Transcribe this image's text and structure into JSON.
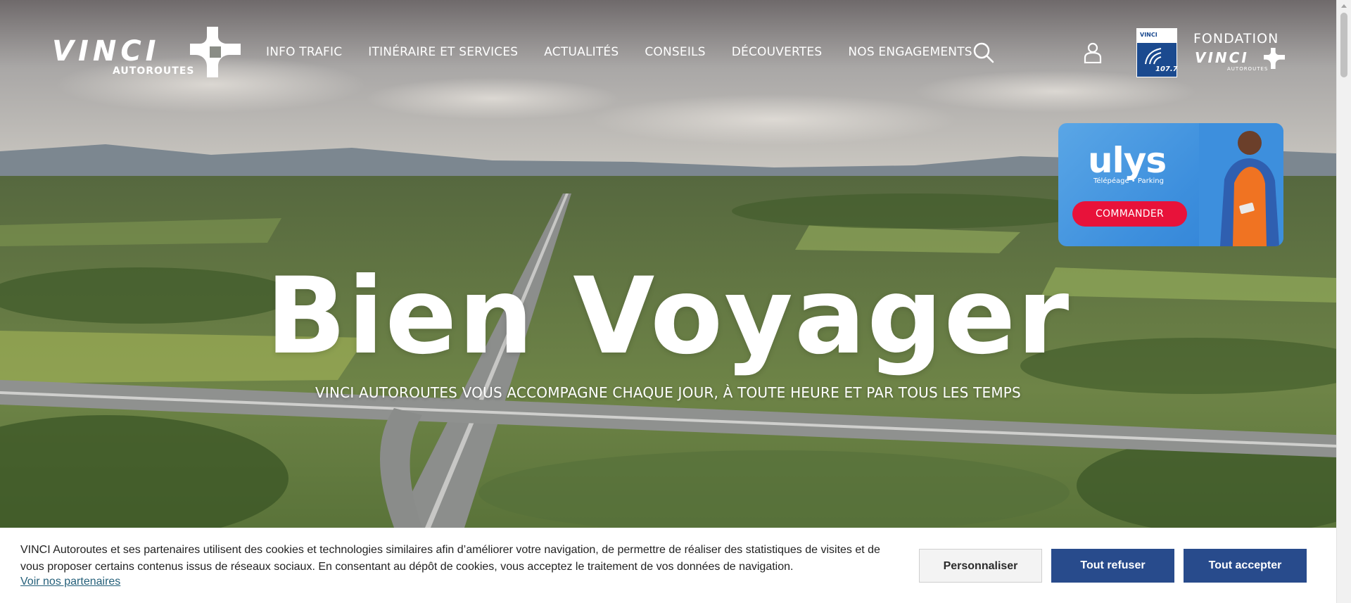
{
  "header": {
    "logo_text": "VINCI",
    "logo_sub": "AUTOROUTES",
    "nav": [
      "INFO TRAFIC",
      "ITINÉRAIRE ET SERVICES",
      "ACTUALITÉS",
      "CONSEILS",
      "DÉCOUVERTES",
      "NOS ENGAGEMENTS"
    ],
    "radio_top": "VINCI",
    "radio_freq": "107.7",
    "fondation_line1": "FONDATION",
    "fondation_line2": "VINCI",
    "fondation_line3": "AUTOROUTES"
  },
  "promo": {
    "brand": "ulys",
    "tagline": "Télépéage • Parking",
    "cta": "COMMANDER"
  },
  "hero": {
    "title": "Bien Voyager",
    "subtitle": "VINCI AUTOROUTES VOUS ACCOMPAGNE CHAQUE JOUR, À TOUTE HEURE ET PAR TOUS LES TEMPS"
  },
  "cookie": {
    "text": "VINCI Autoroutes et ses partenaires utilisent des cookies et technologies similaires afin d’améliorer votre navigation, de permettre de réaliser des statistiques de visites et de vous proposer certains contenus issus de réseaux sociaux. En consentant au dépôt de cookies, vous acceptez le traitement de vos données de navigation.",
    "link": "Voir nos partenaires",
    "btn_personnaliser": "Personnaliser",
    "btn_refuser": "Tout refuser",
    "btn_accepter": "Tout accepter"
  },
  "colors": {
    "primary_button": "#284b8c",
    "promo_red": "#e8123a",
    "promo_blue": "#3d8fdd"
  }
}
